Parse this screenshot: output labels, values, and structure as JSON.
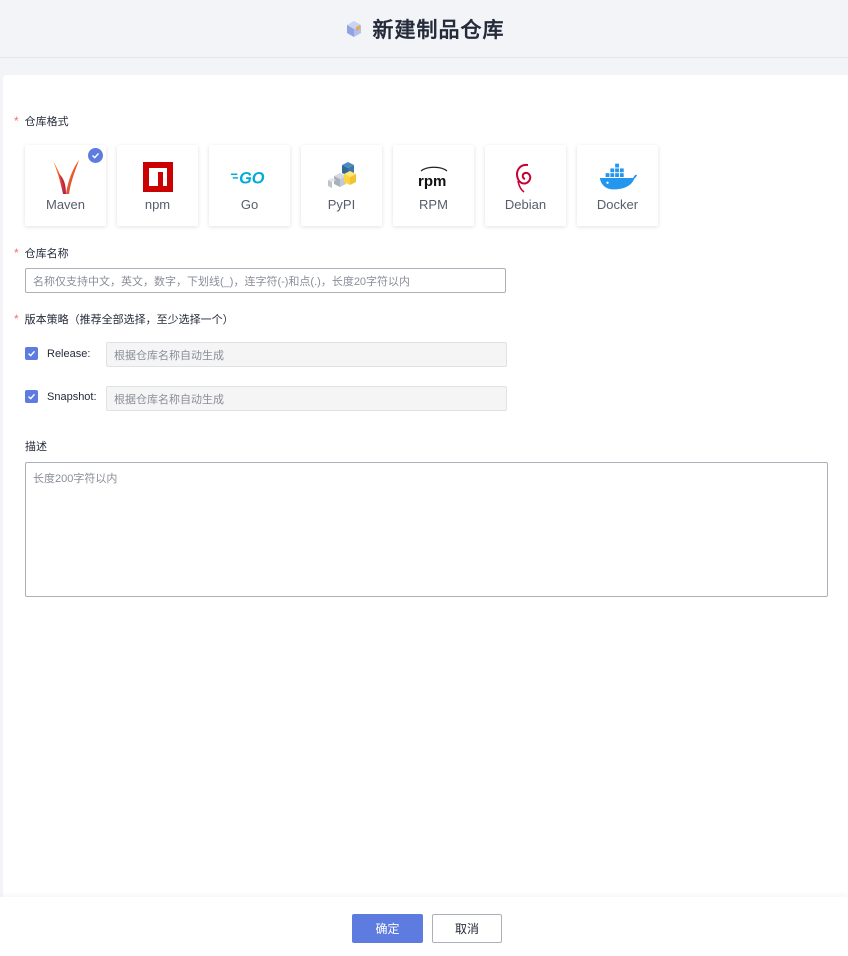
{
  "header": {
    "title": "新建制品仓库",
    "icon": "package-cube-icon"
  },
  "form": {
    "format": {
      "label": "仓库格式",
      "required_mark": "*",
      "selected": "Maven",
      "options": [
        {
          "name": "Maven",
          "icon": "maven-feather-icon",
          "selected": true
        },
        {
          "name": "npm",
          "icon": "npm-logo-icon",
          "selected": false
        },
        {
          "name": "Go",
          "icon": "go-logo-icon",
          "selected": false
        },
        {
          "name": "PyPI",
          "icon": "pypi-logo-icon",
          "selected": false
        },
        {
          "name": "RPM",
          "icon": "rpm-logo-icon",
          "selected": false
        },
        {
          "name": "Debian",
          "icon": "debian-swirl-icon",
          "selected": false
        },
        {
          "name": "Docker",
          "icon": "docker-whale-icon",
          "selected": false
        }
      ]
    },
    "name": {
      "label": "仓库名称",
      "required_mark": "*",
      "value": "",
      "placeholder": "名称仅支持中文，英文，数字，下划线(_)，连字符(-)和点(.)，长度20字符以内"
    },
    "policy": {
      "label": "版本策略（推荐全部选择，至少选择一个）",
      "required_mark": "*",
      "release": {
        "label": "Release:",
        "checked": true,
        "value": "",
        "placeholder": "根据仓库名称自动生成"
      },
      "snapshot": {
        "label": "Snapshot:",
        "checked": true,
        "value": "",
        "placeholder": "根据仓库名称自动生成"
      }
    },
    "description": {
      "label": "描述",
      "value": "",
      "placeholder": "长度200字符以内"
    }
  },
  "footer": {
    "confirm_label": "确定",
    "cancel_label": "取消"
  },
  "colors": {
    "primary": "#5e7ce0",
    "required": "#f66f6a",
    "page_bg": "#f2f4f7",
    "border": "#adb0b8"
  }
}
